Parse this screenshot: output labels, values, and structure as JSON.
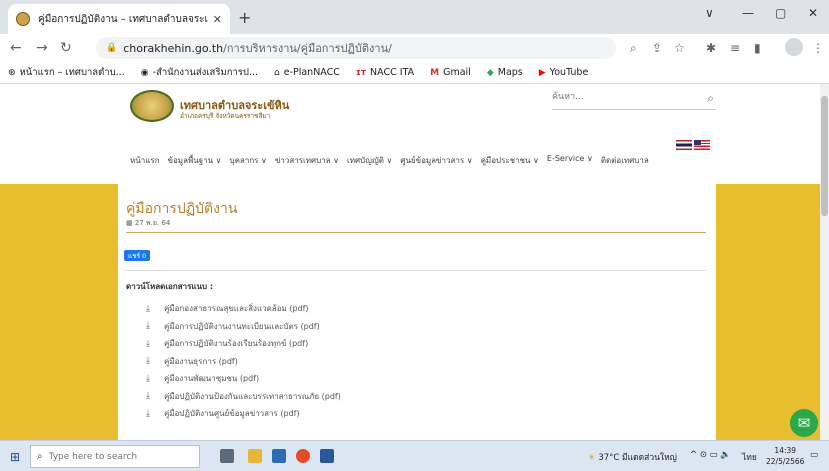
{
  "browser": {
    "tab_title": "คู่มือการปฏิบัติงาน – เทศบาลตำบลจระเ",
    "tab_close": "✕",
    "new_tab": "+",
    "window_controls": [
      "∨",
      "—",
      "▢",
      "✕"
    ],
    "url_domain": "chorakhehin.go.th",
    "url_path": "/การบริหารงาน/คู่มือการปฏิบัติงาน/",
    "bookmarks": [
      {
        "label": "หน้าแรก – เทศบาลตำบ...",
        "icon": "seal-icon"
      },
      {
        "label": "-สำนักงานส่งเสริมการป...",
        "icon": "office-icon"
      },
      {
        "label": "e-PlanNACC",
        "icon": "house-icon"
      },
      {
        "label": "NACC ITA",
        "icon": "ita-icon"
      },
      {
        "label": "Gmail",
        "icon": "gmail-icon"
      },
      {
        "label": "Maps",
        "icon": "maps-icon"
      },
      {
        "label": "YouTube",
        "icon": "youtube-icon"
      }
    ]
  },
  "site": {
    "name": "เทศบาลตำบลจระเข้หิน",
    "subtitle": "อำเภอครบุรี จังหวัดนครราชสีมา",
    "search_placeholder": "ค้นหา...",
    "nav": [
      "หน้าแรก",
      "ข้อมูลพื้นฐาน ∨",
      "บุคลากร ∨",
      "ข่าวสารเทศบาล ∨",
      "เทศบัญญัติ ∨",
      "ศูนย์ข้อมูลข่าวสาร ∨",
      "คู่มือประชาชน ∨",
      "E-Service ∨",
      "ติดต่อเทศบาล"
    ]
  },
  "article": {
    "title": "คู่มือการปฏิบัติงาน",
    "date": "27 พ.ย. 64",
    "share_label": "แชร์ 0",
    "downloads_heading": "ดาวน์โหลดเอกสารแนบ :",
    "downloads": [
      "คู่มือกองสาธารณสุขและสิ่งแวดล้อม (pdf)",
      "คู่มือการปฏิบัติงานงานทะเบียนและบัตร (pdf)",
      "คู่มือการปฏิบัติงานร้องเรียนร้องทุกข์ (pdf)",
      "คู่มืองานธุรการ (pdf)",
      "คู่มืองานพัฒนาชุมชน (pdf)",
      "คู่มือปฏิบัติงานป้องกันและบรรเทาสาธารณภัย (pdf)",
      "คู่มือปฏิบัติงานศูนย์ข้อมูลข่าวสาร (pdf)"
    ]
  },
  "taskbar": {
    "search_placeholder": "Type here to search",
    "weather": "37°C  มีแดดส่วนใหญ่",
    "lang": "ไทย",
    "time": "14:39",
    "date": "22/5/2566"
  },
  "colors": {
    "accent_gold": "#e8bd2e",
    "title_brown": "#b5832c",
    "messenger_green": "#2aa84a"
  }
}
